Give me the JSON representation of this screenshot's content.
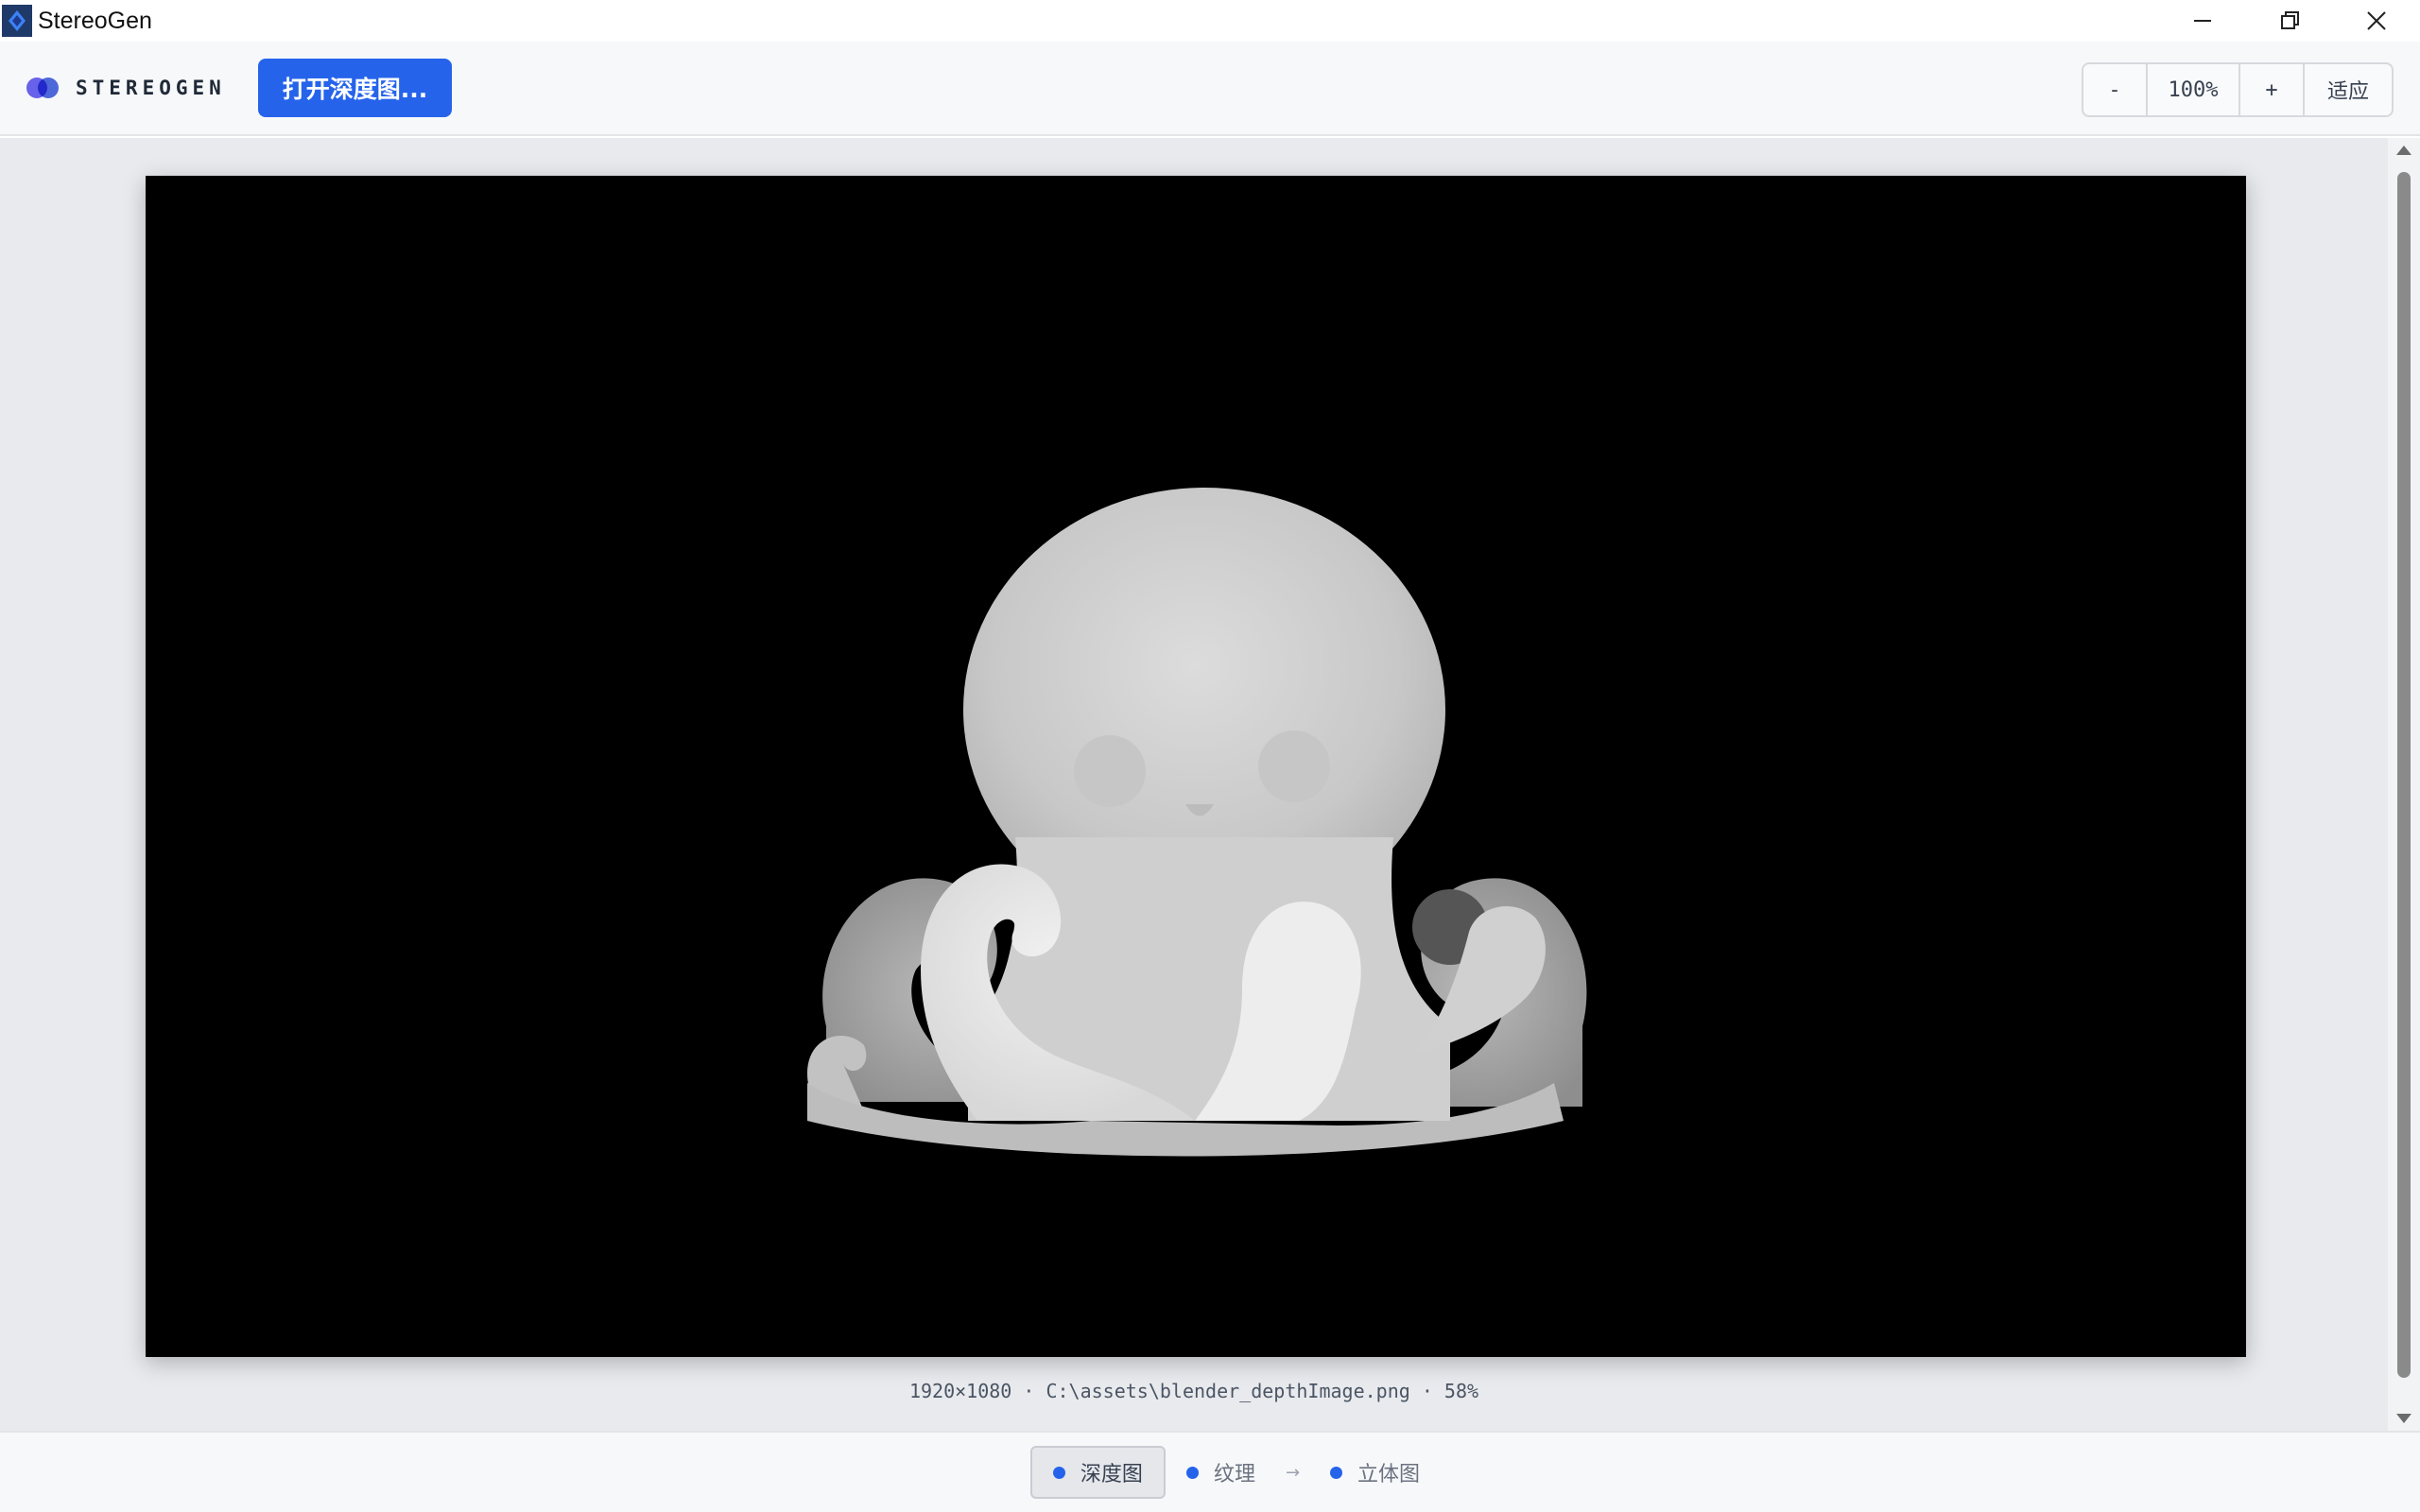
{
  "window": {
    "title": "StereoGen",
    "minimize_icon": "minimize-icon",
    "maximize_icon": "restore-icon",
    "close_icon": "close-icon"
  },
  "toolbar": {
    "brand": "STEREOGEN",
    "open_button": "打开深度图...",
    "zoom_out": "-",
    "zoom_value": "100%",
    "zoom_in": "+",
    "fit": "适应"
  },
  "viewer": {
    "caption": "1920×1080 · C:\\assets\\blender_depthImage.png · 58%"
  },
  "steps": {
    "items": [
      {
        "label": "深度图",
        "active": true
      },
      {
        "label": "纹理",
        "active": false
      },
      {
        "label": "立体图",
        "active": false
      }
    ],
    "arrow": "→"
  },
  "colors": {
    "accent": "#2563eb",
    "brand_logo": "#4f46e5",
    "canvas_bg": "#000000"
  }
}
